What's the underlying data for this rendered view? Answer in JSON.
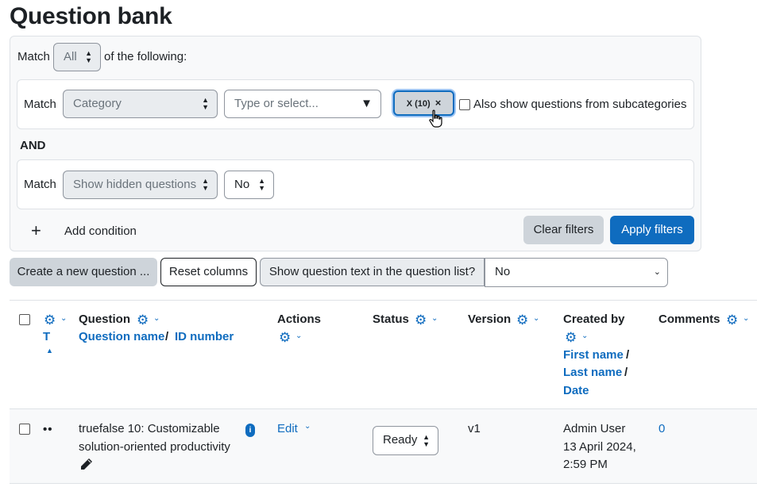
{
  "page": {
    "title": "Question bank"
  },
  "filters": {
    "match_label": "Match",
    "match_all_value": "All",
    "of_following": "of the following:",
    "condition1": {
      "match_label": "Match",
      "type_value": "Category",
      "search_placeholder": "Type or select...",
      "chip_label": "X (10)",
      "chip_remove": "×",
      "subcategories_label": "Also show questions from subcategories"
    },
    "and_label": "AND",
    "condition2": {
      "match_label": "Match",
      "type_value": "Show hidden questions",
      "value": "No"
    },
    "add_condition_icon": "+",
    "add_condition_label": "Add condition",
    "clear_label": "Clear filters",
    "apply_label": "Apply filters"
  },
  "toolbar": {
    "create_label": "Create a new question ...",
    "reset_columns_label": "Reset columns",
    "show_text_label": "Show question text in the question list?",
    "show_text_value": "No"
  },
  "table": {
    "headers": {
      "type_sort": "T",
      "question": "Question",
      "question_name": "Question name",
      "slash": "/",
      "id_number": "ID number",
      "actions": "Actions",
      "status": "Status",
      "version": "Version",
      "created_by": "Created by",
      "first_name": "First name",
      "last_name": "Last name",
      "date": "Date",
      "comments": "Comments"
    },
    "rows": [
      {
        "type_icon": "••",
        "name_line1": "truefalse 10: Customizable",
        "name_line2": "solution-oriented productivity",
        "info_badge": "i",
        "edit_label": "Edit",
        "status": "Ready",
        "version": "v1",
        "created_by": "Admin User",
        "created_date": "13 April 2024,",
        "created_time": "2:59 PM",
        "comments": "0"
      }
    ]
  },
  "icons": {
    "gear": "gear-icon",
    "chevron": "chevron-down-icon",
    "pencil": "pencil-icon",
    "cursor": "hand-pointer-icon"
  },
  "colors": {
    "accent": "#0f6cbf",
    "secondary": "#ced4da"
  }
}
